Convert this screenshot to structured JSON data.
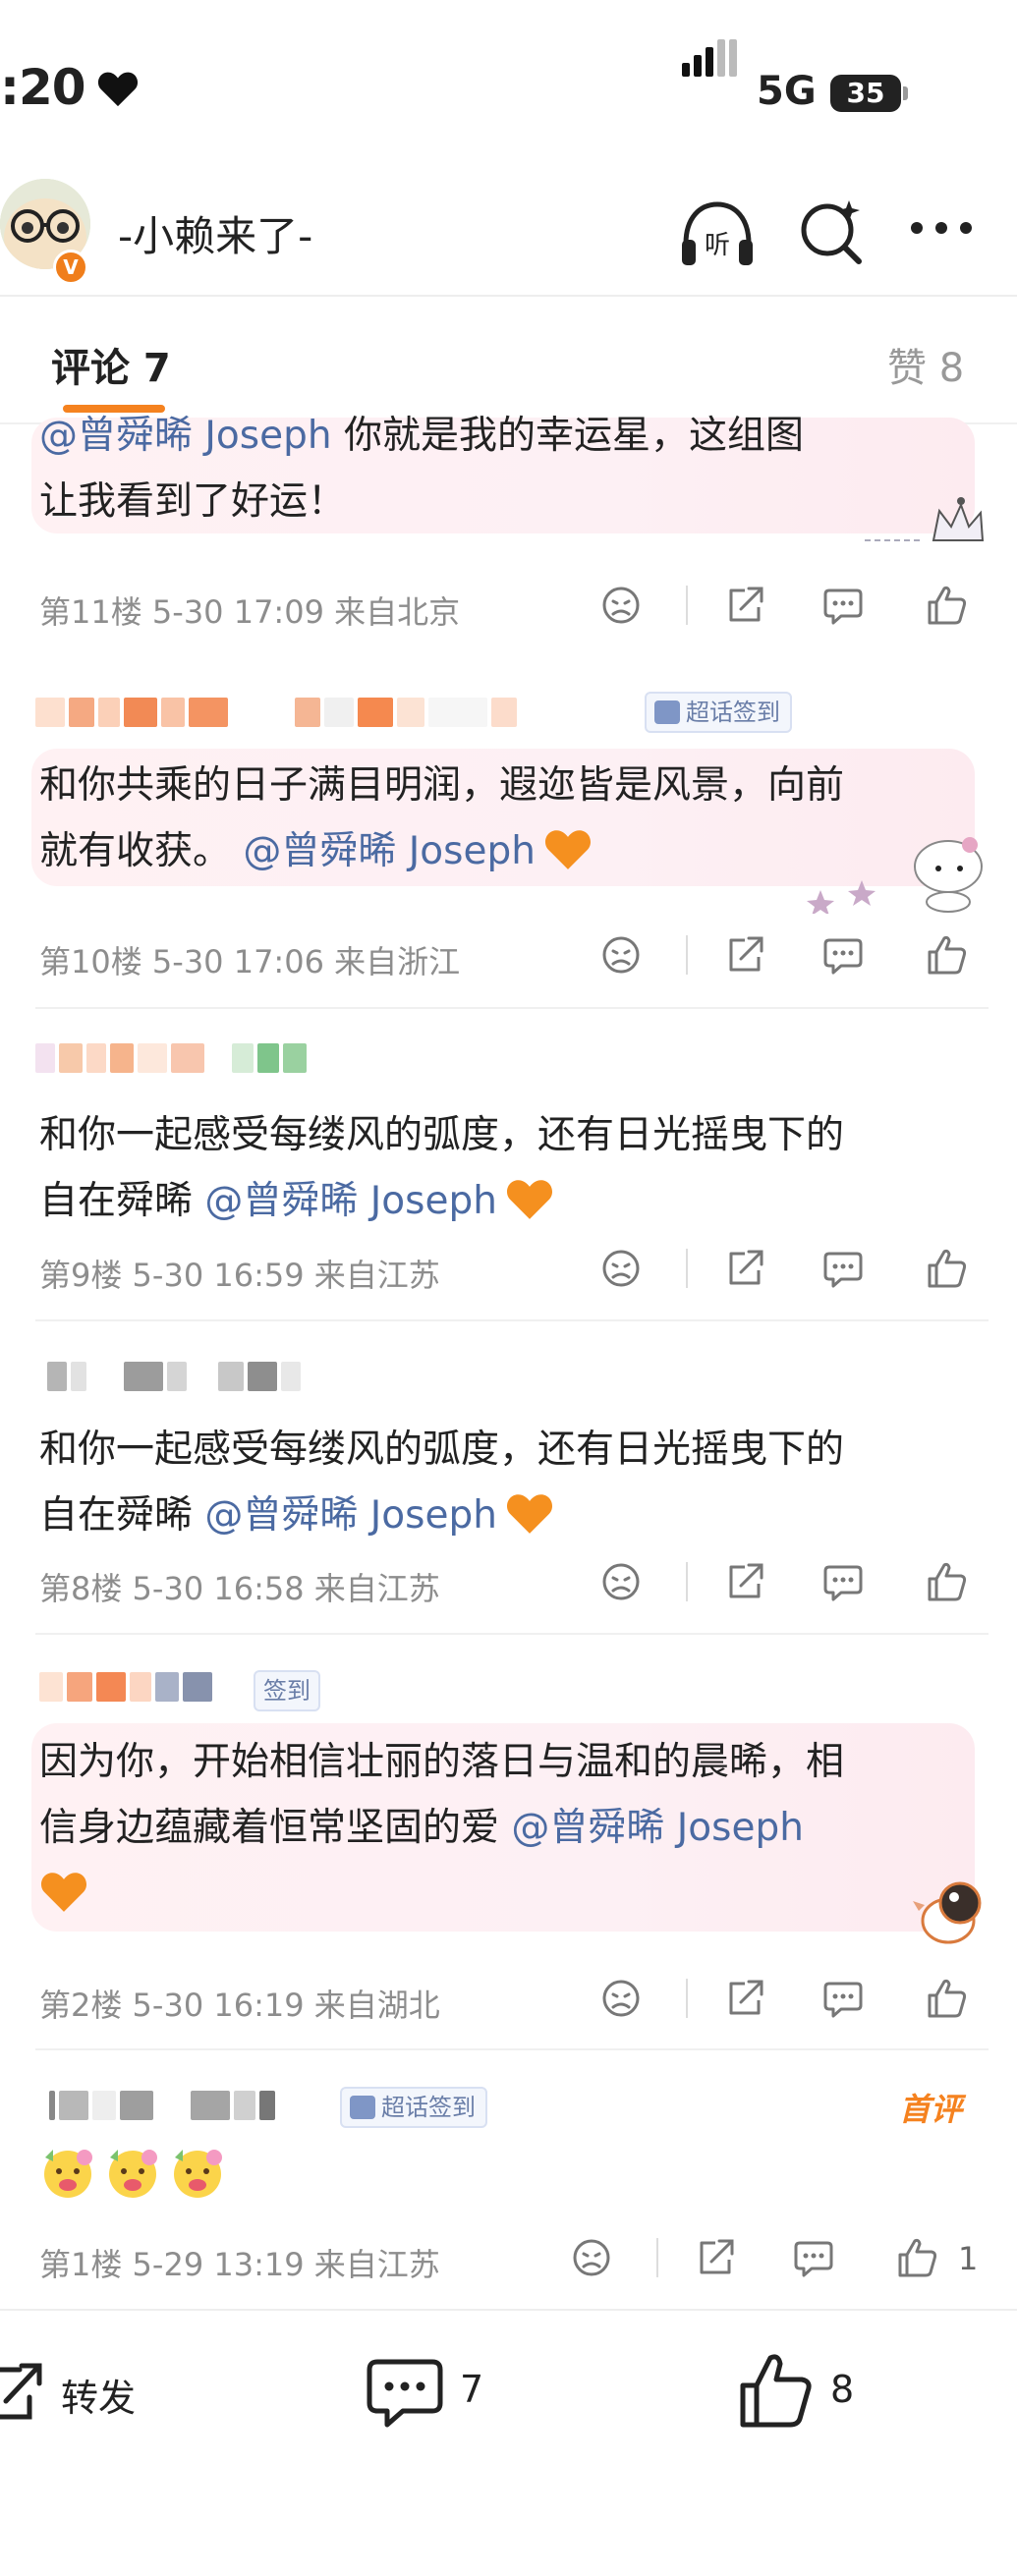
{
  "status_bar": {
    "time": ":20",
    "network": "5G",
    "battery": "35"
  },
  "header": {
    "name": "-小赖来了-",
    "verified_badge": "V"
  },
  "tabs": {
    "comments_label": "评论 7",
    "likes_label": "赞 8"
  },
  "comments": [
    {
      "text_line1_prefix": "@曾舜晞 Joseph",
      "text_line1_suffix": " 你就是我的幸运星，这组图",
      "text_line2": "让我看到了好运！",
      "floor": "第11楼",
      "time": "5-30 17:09",
      "location": "来自北京"
    },
    {
      "badge": "超话签到",
      "text_line1": "和你共乘的日子满目明润，遐迩皆是风景，向前",
      "text_line2_prefix": "就有收获。 ",
      "mention": "@曾舜晞 Joseph",
      "floor": "第10楼",
      "time": "5-30 17:06",
      "location": "来自浙江"
    },
    {
      "text_line1": "和你一起感受每缕风的弧度，还有日光摇曳下的",
      "text_line2_prefix": "自在舜晞 ",
      "mention": "@曾舜晞 Joseph",
      "floor": "第9楼",
      "time": "5-30 16:59",
      "location": "来自江苏"
    },
    {
      "text_line1": "和你一起感受每缕风的弧度，还有日光摇曳下的",
      "text_line2_prefix": "自在舜晞 ",
      "mention": "@曾舜晞 Joseph",
      "floor": "第8楼",
      "time": "5-30 16:58",
      "location": "来自江苏"
    },
    {
      "badge": "签到",
      "text_line1": "因为你，开始相信壮丽的落日与温和的晨晞，相",
      "text_line2_prefix": "信身边蕴藏着恒常坚固的爱 ",
      "mention": "@曾舜晞 Joseph",
      "floor": "第2楼",
      "time": "5-30 16:19",
      "location": "来自湖北"
    },
    {
      "badge": "超话签到",
      "first_label": "首评",
      "emoji_count": 3,
      "floor": "第1楼",
      "time": "5-29 13:19",
      "location": "来自江苏",
      "likes": "1"
    }
  ],
  "bottom_bar": {
    "share_label": "转发",
    "comment_count": "7",
    "like_count": "8"
  },
  "icons": [
    "heart-icon",
    "signal-icon",
    "avatar",
    "listen-icon",
    "search-icon",
    "more-icon",
    "dislike-icon",
    "share-icon",
    "reply-icon",
    "like-icon",
    "orange-heart-icon",
    "emoji-icon"
  ],
  "colors": {
    "accent": "#f5821f",
    "mention": "#4b6aa2",
    "meta": "#8d8d8d",
    "highlight": "#fff1f3"
  }
}
